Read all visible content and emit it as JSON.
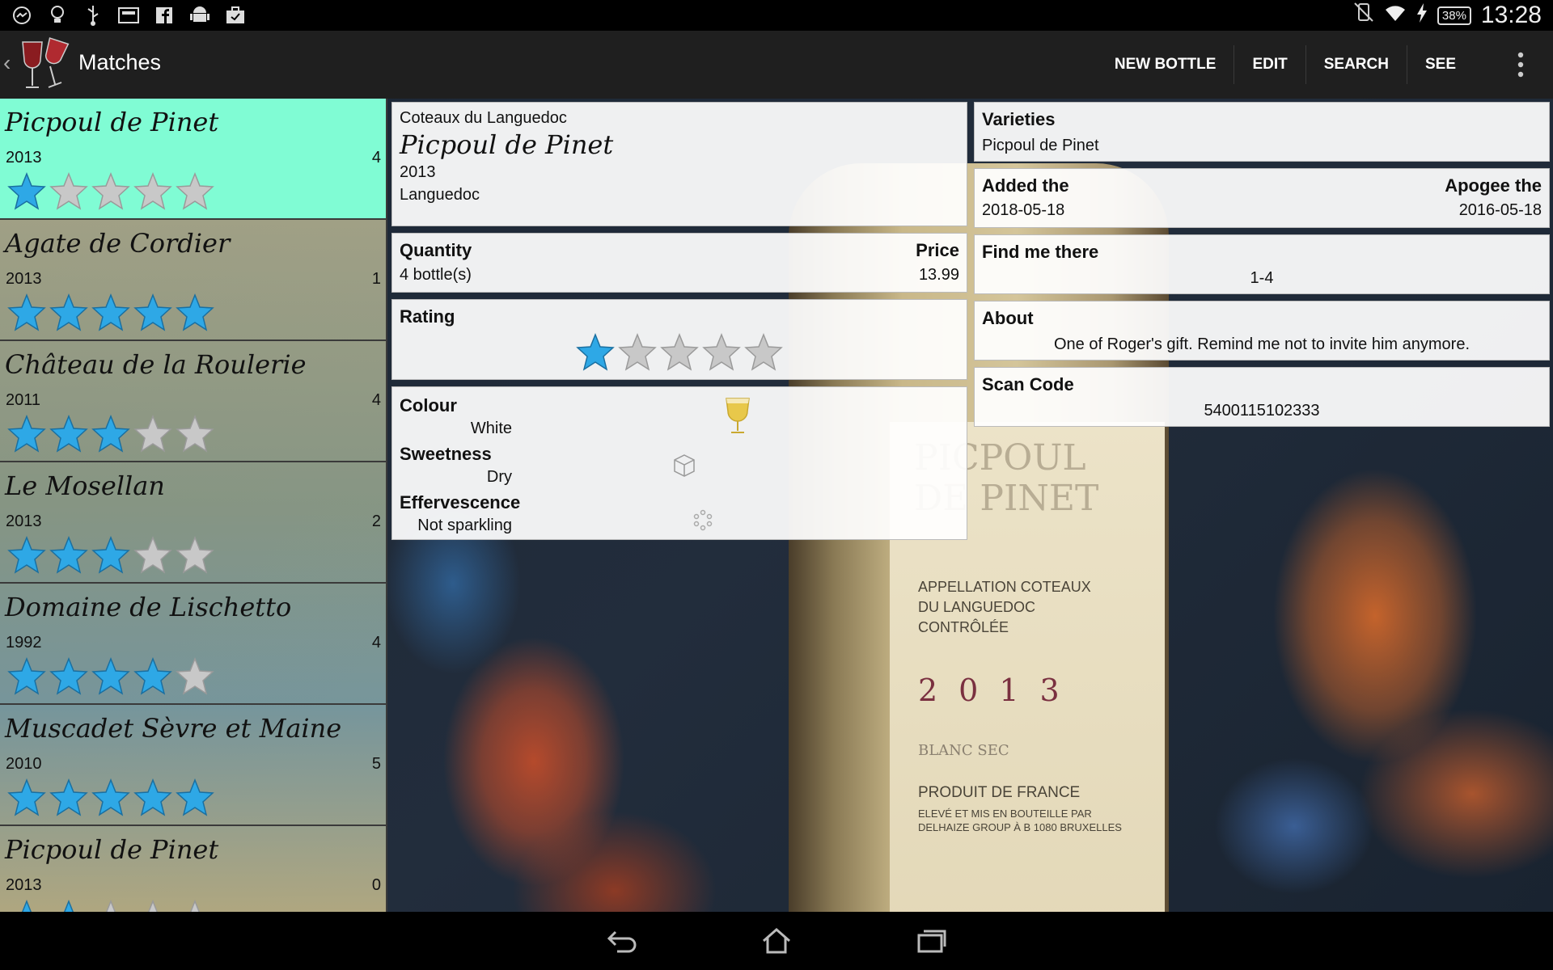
{
  "statusbar": {
    "time": "13:28",
    "battery": "38%",
    "left_icons": [
      "messenger-icon",
      "lightbulb-icon",
      "usb-icon",
      "newspaper-icon",
      "facebook-icon",
      "android-icon",
      "briefcase-icon"
    ]
  },
  "actionbar": {
    "title": "Matches",
    "new_bottle": "NEW BOTTLE",
    "edit": "EDIT",
    "search": "SEARCH",
    "see": "SEE"
  },
  "wines": [
    {
      "name": "Picpoul de Pinet",
      "year": "2013",
      "count": "4",
      "rating": 1
    },
    {
      "name": "Agate de Cordier",
      "year": "2013",
      "count": "1",
      "rating": 5
    },
    {
      "name": "Château de la Roulerie",
      "year": "2011",
      "count": "4",
      "rating": 3
    },
    {
      "name": "Le Mosellan",
      "year": "2013",
      "count": "2",
      "rating": 3
    },
    {
      "name": "Domaine de Lischetto",
      "year": "1992",
      "count": "4",
      "rating": 4
    },
    {
      "name": "Muscadet Sèvre et Maine",
      "year": "2010",
      "count": "5",
      "rating": 5
    },
    {
      "name": "Picpoul de Pinet",
      "year": "2013",
      "count": "0",
      "rating": 2
    }
  ],
  "detail": {
    "region": "Coteaux du Languedoc",
    "name": "Picpoul de Pinet",
    "year": "2013",
    "appellation": "Languedoc",
    "quantity_label": "Quantity",
    "quantity": "4 bottle(s)",
    "price_label": "Price",
    "price": "13.99",
    "rating_label": "Rating",
    "rating": 1,
    "colour_label": "Colour",
    "colour": "White",
    "sweetness_label": "Sweetness",
    "sweetness": "Dry",
    "effervescence_label": "Effervescence",
    "effervescence": "Not sparkling",
    "varieties_label": "Varieties",
    "varieties": "Picpoul de Pinet",
    "added_label": "Added the",
    "added": "2018-05-18",
    "apogee_label": "Apogee the",
    "apogee": "2016-05-18",
    "find_label": "Find me there",
    "find": "1-4",
    "about_label": "About",
    "about": "One of Roger's gift. Remind me not to invite him anymore.",
    "scan_label": "Scan Code",
    "scan": "5400115102333"
  },
  "bottle_label": {
    "title": "PICPOUL DE PINET",
    "appellation_lines": [
      "APPELLATION COTEAUX",
      "DU LANGUEDOC",
      "CONTRÔLÉE"
    ],
    "year": "2013",
    "type": "BLANC SEC",
    "origin": "PRODUIT DE FRANCE",
    "bottler_lines": [
      "ELEVÉ ET MIS EN BOUTEILLE PAR",
      "DELHAIZE GROUP À B 1080 BRUXELLES"
    ]
  },
  "colors": {
    "star_on": "#2ea8e6",
    "star_off": "#c8c8c8",
    "selected_row": "#80fcd4"
  }
}
